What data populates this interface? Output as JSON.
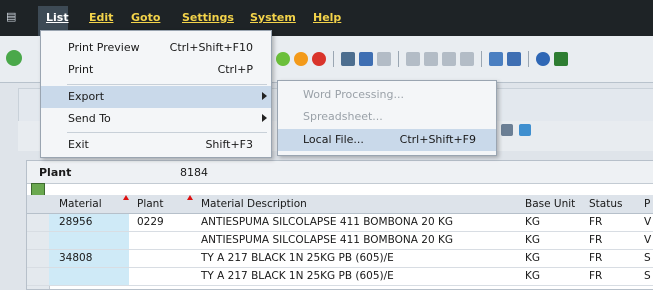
{
  "menubar": {
    "items": [
      "List",
      "Edit",
      "Goto",
      "Settings",
      "System",
      "Help"
    ]
  },
  "list_menu": {
    "items": [
      {
        "label": "Print Preview",
        "shortcut": "Ctrl+Shift+F10"
      },
      {
        "label": "Print",
        "shortcut": "Ctrl+P"
      },
      {
        "label": "Export",
        "shortcut": ""
      },
      {
        "label": "Send To",
        "shortcut": ""
      },
      {
        "label": "Exit",
        "shortcut": "Shift+F3"
      }
    ]
  },
  "export_submenu": {
    "items": [
      {
        "label": "Word Processing...",
        "shortcut": "",
        "enabled": false
      },
      {
        "label": "Spreadsheet...",
        "shortcut": "",
        "enabled": false
      },
      {
        "label": "Local File...",
        "shortcut": "Ctrl+Shift+F9",
        "enabled": true
      }
    ]
  },
  "grid": {
    "plant_label": "Plant",
    "plant_value": "8184",
    "columns": [
      "Material",
      "Plant",
      "Material Description",
      "Base Unit",
      "Status",
      "P"
    ],
    "rows": [
      {
        "material": "28956",
        "plant": "0229",
        "desc": "ANTIESPUMA SILCOLAPSE 411 BOMBONA 20 KG",
        "unit": "KG",
        "status": "FR",
        "p": "V"
      },
      {
        "material": "",
        "plant": "",
        "desc": "ANTIESPUMA SILCOLAPSE 411 BOMBONA 20 KG",
        "unit": "KG",
        "status": "FR",
        "p": "V"
      },
      {
        "material": "34808",
        "plant": "",
        "desc": "TY A 217 BLACK 1N 25KG PB (605)/E",
        "unit": "KG",
        "status": "FR",
        "p": "S"
      },
      {
        "material": "",
        "plant": "",
        "desc": "TY A 217 BLACK 1N 25KG PB (605)/E",
        "unit": "KG",
        "status": "FR",
        "p": "S"
      }
    ]
  },
  "colors": {
    "menubar": "#1e2326",
    "menu_text": "#f3d34a",
    "highlight": "#c9d9ea",
    "material_cell": "#cfeaf7"
  }
}
